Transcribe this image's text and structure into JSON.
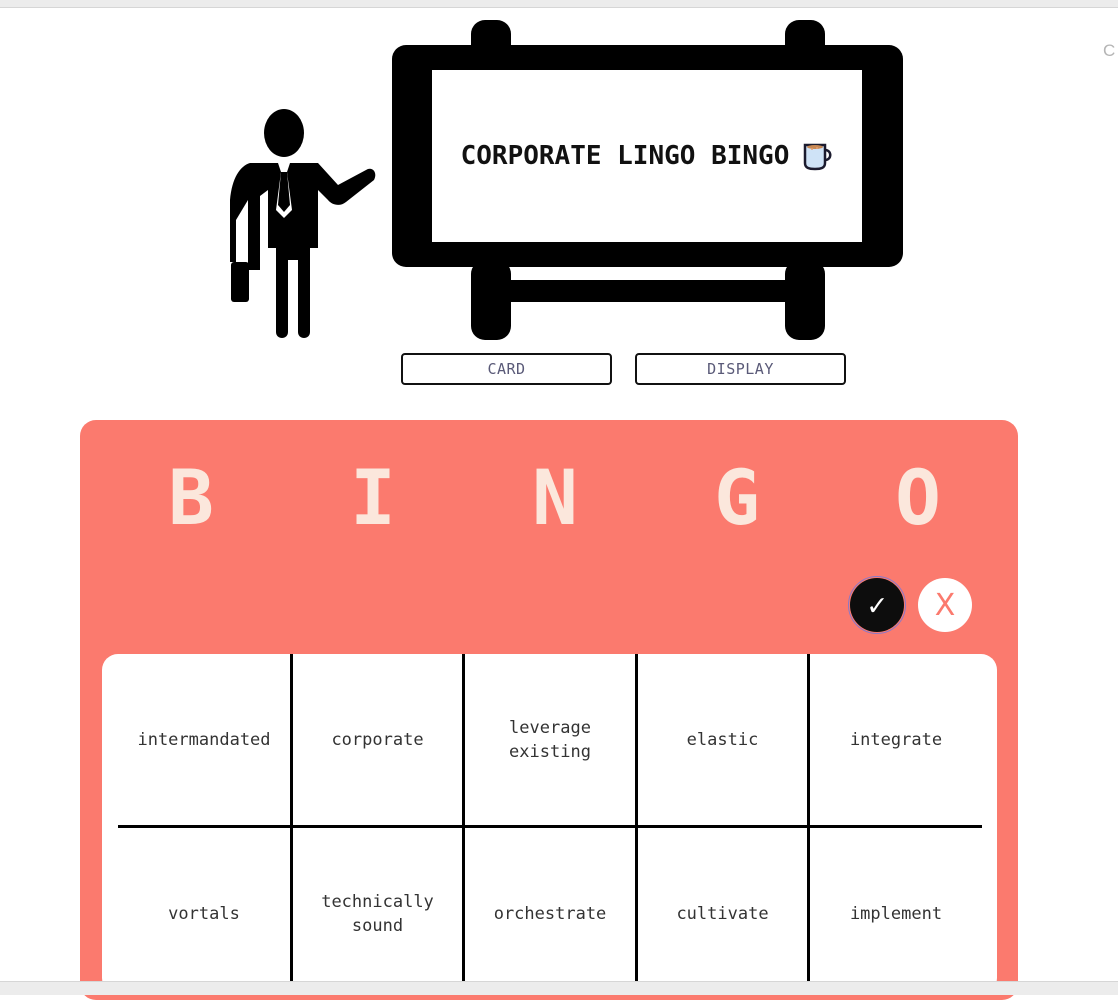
{
  "app": {
    "title": "CORPORATE LINGO BINGO",
    "title_icon": "coffee-mug-icon",
    "corner_text": "C"
  },
  "nav": {
    "card_label": "CARD",
    "display_label": "DISPLAY"
  },
  "bingo": {
    "letters": [
      "B",
      "I",
      "N",
      "G",
      "O"
    ],
    "confirm_icon": "checkmark-icon",
    "confirm_glyph": "✓",
    "reject_icon": "close-icon",
    "reject_glyph": "X",
    "cells": [
      [
        "intermandated",
        "corporate",
        "leverage existing",
        "elastic",
        "integrate"
      ],
      [
        "vortals",
        "technically sound",
        "orchestrate",
        "cultivate",
        "implement"
      ]
    ]
  },
  "colors": {
    "card_background": "#fb7a6e",
    "letter_color": "#fbe7dc",
    "ink": "#111111"
  }
}
